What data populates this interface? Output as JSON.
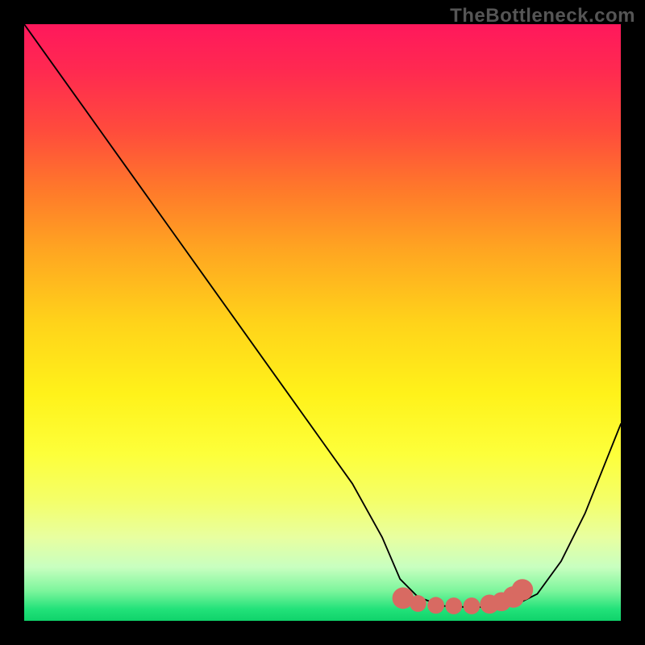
{
  "watermark": "TheBottleneck.com",
  "chart_data": {
    "type": "line",
    "title": "",
    "xlabel": "",
    "ylabel": "",
    "xlim": [
      0,
      100
    ],
    "ylim": [
      0,
      100
    ],
    "x": [
      0,
      5,
      10,
      15,
      20,
      25,
      30,
      35,
      40,
      45,
      50,
      55,
      60,
      63,
      66,
      70,
      74,
      78,
      82,
      86,
      90,
      94,
      98,
      100
    ],
    "values": [
      100,
      93,
      86,
      79,
      72,
      65,
      58,
      51,
      44,
      37,
      30,
      23,
      14,
      7,
      4,
      2.5,
      2.3,
      2.3,
      2.5,
      4.5,
      10,
      18,
      28,
      33
    ],
    "gradient_stops": [
      {
        "pos": 0,
        "color": "#ff185c"
      },
      {
        "pos": 50,
        "color": "#ffea1a"
      },
      {
        "pos": 100,
        "color": "#0fd36a"
      }
    ],
    "markers": {
      "color": "#d86a62",
      "points": [
        {
          "x": 63.5,
          "y": 3.8,
          "r": 1.8
        },
        {
          "x": 66,
          "y": 2.9,
          "r": 1.4
        },
        {
          "x": 69,
          "y": 2.6,
          "r": 1.4
        },
        {
          "x": 72,
          "y": 2.5,
          "r": 1.4
        },
        {
          "x": 75,
          "y": 2.5,
          "r": 1.4
        },
        {
          "x": 78,
          "y": 2.8,
          "r": 1.6
        },
        {
          "x": 80,
          "y": 3.2,
          "r": 1.6
        },
        {
          "x": 82,
          "y": 4.0,
          "r": 1.8
        },
        {
          "x": 83.5,
          "y": 5.2,
          "r": 1.8
        }
      ]
    }
  }
}
